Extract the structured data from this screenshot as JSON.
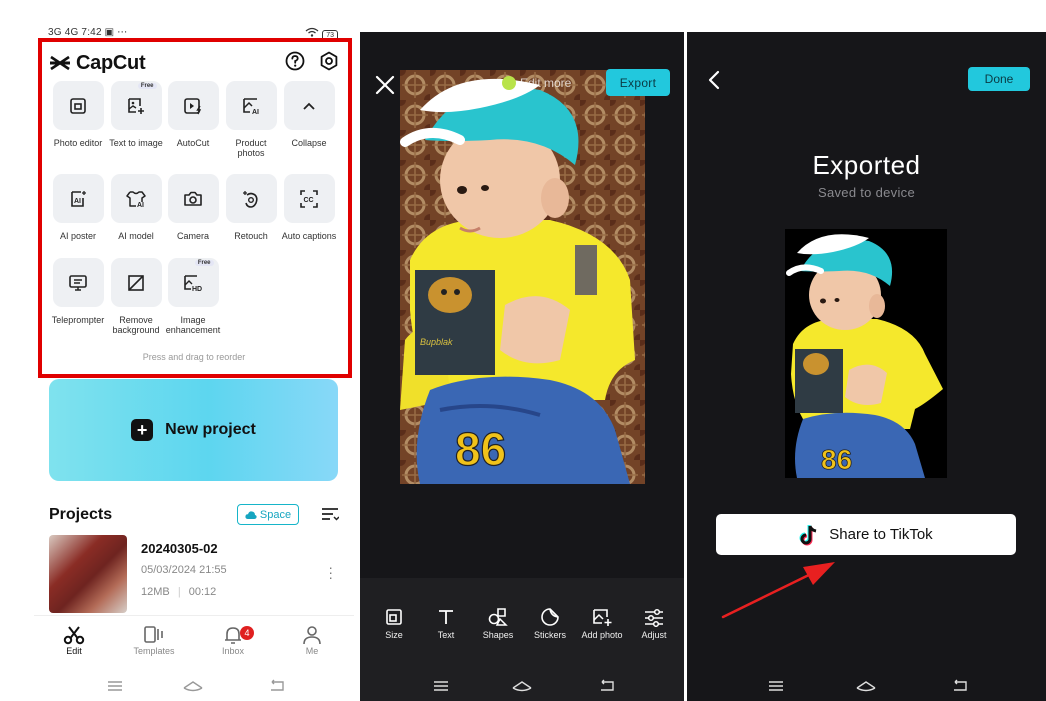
{
  "statusbar": {
    "left": "3G 4G 7:42 ▣ ⋯",
    "battery": "73"
  },
  "capcut": {
    "brand": "CapCut",
    "help_icon": "help-circle-icon",
    "settings_icon": "gear-icon",
    "tools": [
      {
        "label": "Photo editor",
        "icon": "photo-editor-icon"
      },
      {
        "label": "Text to image",
        "icon": "text-to-image-icon",
        "badge": "Free"
      },
      {
        "label": "AutoCut",
        "icon": "autocut-icon"
      },
      {
        "label": "Product photos",
        "icon": "product-photos-icon"
      },
      {
        "label": "Collapse",
        "icon": "chevron-up-icon"
      },
      {
        "label": "AI poster",
        "icon": "ai-poster-icon"
      },
      {
        "label": "AI model",
        "icon": "ai-model-icon"
      },
      {
        "label": "Camera",
        "icon": "camera-icon"
      },
      {
        "label": "Retouch",
        "icon": "retouch-icon"
      },
      {
        "label": "Auto captions",
        "icon": "auto-captions-icon"
      },
      {
        "label": "Teleprompter",
        "icon": "teleprompter-icon"
      },
      {
        "label": "Remove background",
        "icon": "remove-background-icon"
      },
      {
        "label": "Image enhancement",
        "icon": "image-enhancement-icon",
        "badge": "Free"
      }
    ],
    "reorder_hint": "Press and drag to reorder",
    "new_project": "New project",
    "projects": {
      "title": "Projects",
      "space_label": "Space",
      "items": [
        {
          "name": "20240305-02",
          "date": "05/03/2024 21:55",
          "size": "12MB",
          "duration": "00:12"
        }
      ]
    },
    "nav": [
      {
        "label": "Edit",
        "icon": "scissors-icon",
        "active": true
      },
      {
        "label": "Templates",
        "icon": "templates-icon"
      },
      {
        "label": "Inbox",
        "icon": "bell-icon",
        "badge": "4"
      },
      {
        "label": "Me",
        "icon": "person-icon"
      }
    ]
  },
  "editor": {
    "export_label": "Export",
    "edit_more": "Edit more",
    "tools": [
      {
        "label": "Size",
        "icon": "size-icon"
      },
      {
        "label": "Text",
        "icon": "text-icon"
      },
      {
        "label": "Shapes",
        "icon": "shapes-icon"
      },
      {
        "label": "Stickers",
        "icon": "stickers-icon"
      },
      {
        "label": "Add photo",
        "icon": "add-photo-icon"
      },
      {
        "label": "Adjust",
        "icon": "adjust-icon"
      }
    ]
  },
  "exported": {
    "done_label": "Done",
    "title": "Exported",
    "subtitle": "Saved to device",
    "share_label": "Share to TikTok",
    "accent_color": "#22c8dd",
    "annotation_arrow_color": "#e82020"
  }
}
